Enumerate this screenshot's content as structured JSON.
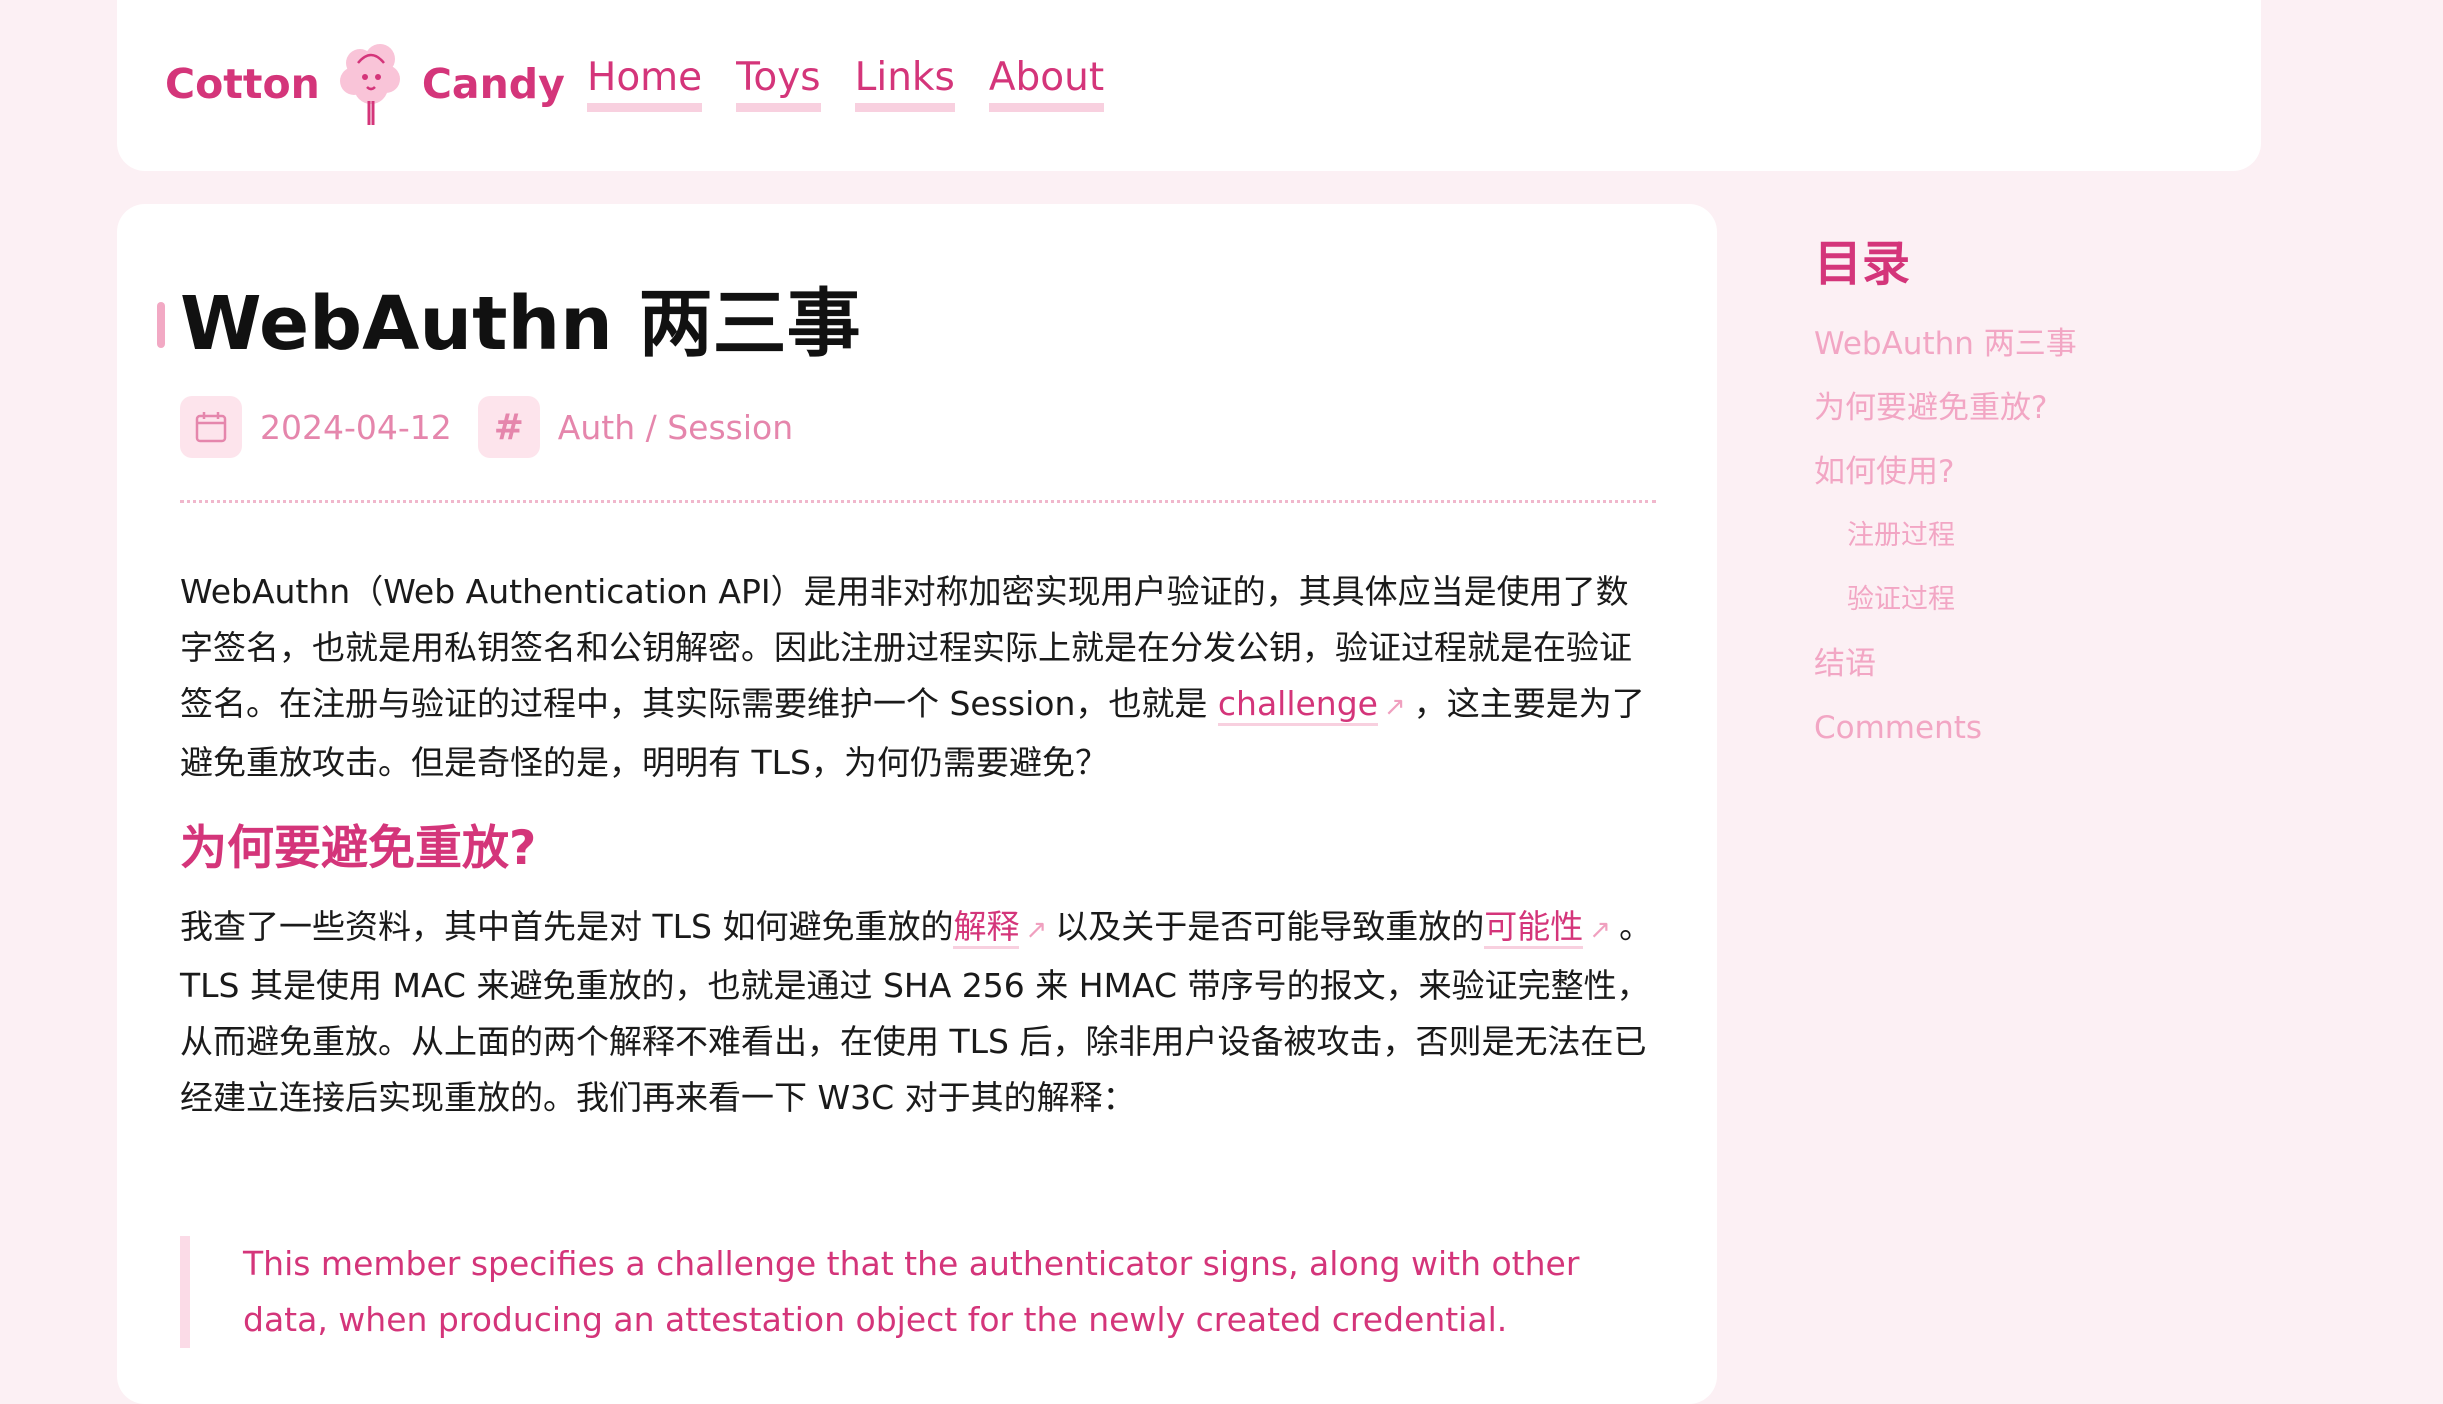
{
  "header": {
    "brand_left": "Cotton",
    "brand_right": "Candy",
    "logo_icon": "cotton-candy-icon",
    "nav": [
      {
        "label": "Home"
      },
      {
        "label": "Toys"
      },
      {
        "label": "Links"
      },
      {
        "label": "About"
      }
    ]
  },
  "article": {
    "title": "WebAuthn 两三事",
    "date": "2024-04-12",
    "date_icon": "calendar-icon",
    "tag_icon": "hash-icon",
    "tag_symbol": "#",
    "category": "Auth / Session",
    "para1": {
      "before": "WebAuthn（Web Authentication API）是用非对称加密实现用户验证的，其具体应当是使用了数字签名，也就是用私钥签名和公钥解密。因此注册过程实际上就是在分发公钥，验证过程就是在验证签名。在注册与验证的过程中，其实际需要维护一个 Session，也就是 ",
      "link": "challenge",
      "after": "，这主要是为了避免重放攻击。但是奇怪的是，明明有 TLS，为何仍需要避免？"
    },
    "h2_replay": "为何要避免重放?",
    "para2": {
      "before": "我查了一些资料，其中首先是对 TLS 如何避免重放的",
      "link1": "解释",
      "middle": "以及关于是否可能导致重放的",
      "link2": "可能性",
      "after": "。TLS 其是使用 MAC 来避免重放的，也就是通过 SHA 256 来 HMAC 带序号的报文，来验证完整性，从而避免重放。从上面的两个解释不难看出，在使用 TLS 后，除非用户设备被攻击，否则是无法在已经建立连接后实现重放的。我们再来看一下 W3C 对于其的解释："
    },
    "external_link_icon": "↗",
    "quote": "This member specifies a challenge that the authenticator signs, along with other data, when producing an attestation object for the newly created credential."
  },
  "toc": {
    "title": "目录",
    "items": [
      {
        "label": "WebAuthn 两三事"
      },
      {
        "label": "为何要避免重放?"
      },
      {
        "label": "如何使用?"
      },
      {
        "label": "注册过程"
      },
      {
        "label": "验证过程"
      },
      {
        "label": "结语"
      },
      {
        "label": "Comments"
      }
    ]
  },
  "colors": {
    "accent": "#d4357a",
    "accent_light": "#f2a6c4",
    "background": "#fcf0f4",
    "card": "#ffffff"
  }
}
